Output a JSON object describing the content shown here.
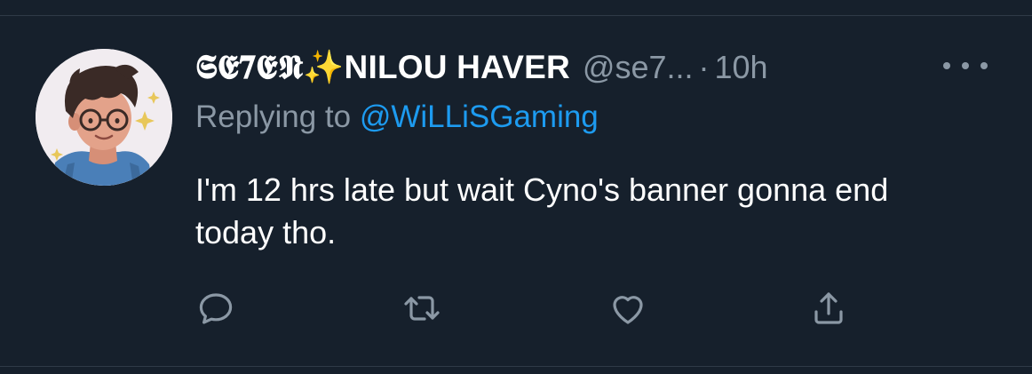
{
  "tweet": {
    "display_name": "𝕾𝕰𝟕𝕰𝕹✨NILOU HAVER",
    "handle": "@se7...",
    "separator": "·",
    "time": "10h",
    "replying_prefix": "Replying to ",
    "replying_to": "@WiLLiSGaming",
    "text": "I'm 12 hrs late but wait Cyno's banner gonna end today tho."
  },
  "icons": {
    "more": "more-horizontal-icon",
    "reply": "reply-icon",
    "retweet": "retweet-icon",
    "like": "heart-icon",
    "share": "share-icon"
  },
  "colors": {
    "background": "#16202c",
    "text": "#ffffff",
    "secondary": "#8b98a5",
    "link": "#1d9bf0",
    "divider": "#2f3a47"
  }
}
